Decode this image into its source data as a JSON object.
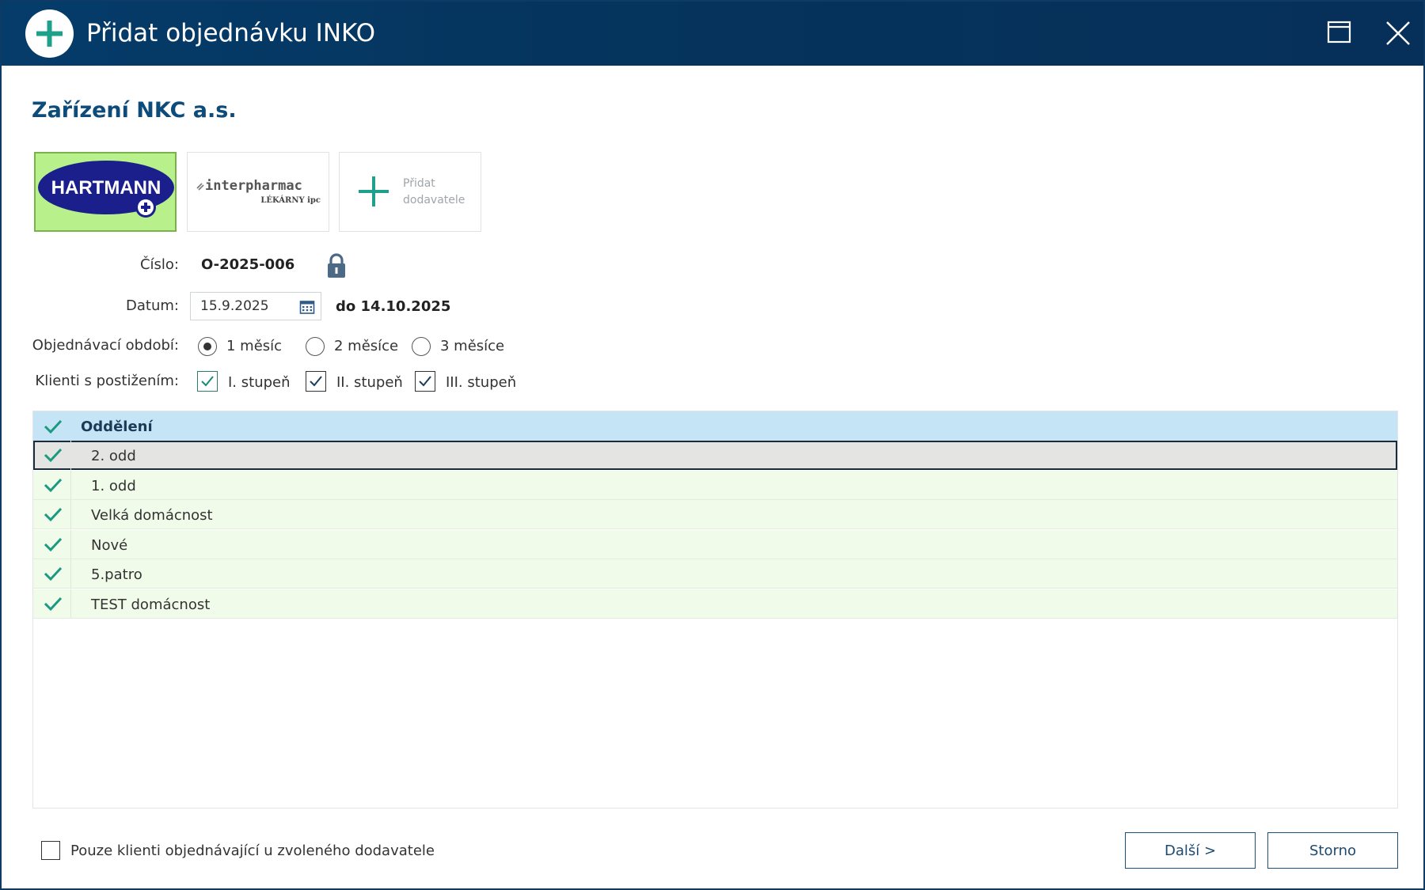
{
  "window": {
    "title": "Přidat objednávku INKO",
    "title_bar_color": "#053c6a",
    "accent_color": "#1fa08a"
  },
  "company": {
    "name": "Zařízení NKC a.s."
  },
  "suppliers": [
    {
      "name": "HARTMANN",
      "selected": true,
      "logo": "hartmann-logo",
      "highlight_color": "#b8f08b"
    },
    {
      "name": "interpharmac",
      "subtitle": "LÉKÁRNY ipc",
      "selected": false,
      "logo": "interpharmac-logo"
    },
    {
      "label": "Přidat dodavatele",
      "label_line1": "Přidat",
      "label_line2": "dodavatele",
      "icon": "plus-icon"
    }
  ],
  "form": {
    "cislo_label": "Číslo:",
    "cislo_value": "O-2025-006",
    "cislo_icon": "lock-icon",
    "datum_label": "Datum:",
    "datum_value": "15.9.2025",
    "datum_icon": "calendar-icon",
    "datum_to": "do 14.10.2025",
    "obdobi_label": "Objednávací období:",
    "obdobi_options": [
      {
        "label": "1 měsíc",
        "selected": true
      },
      {
        "label": "2 měsíce",
        "selected": false
      },
      {
        "label": "3 měsíce",
        "selected": false
      }
    ],
    "klienti_label": "Klienti s postižením:",
    "klienti_options": [
      {
        "label": "I. stupeň",
        "checked": true
      },
      {
        "label": "II. stupeň",
        "checked": true
      },
      {
        "label": "III. stupeň",
        "checked": true
      }
    ]
  },
  "table": {
    "header": "Oddělení",
    "header_bg": "#c5e4f6",
    "row_bg": "#f1fbea",
    "rows": [
      {
        "name": "2. odd",
        "checked": true,
        "selected": true
      },
      {
        "name": "1. odd",
        "checked": true,
        "selected": false
      },
      {
        "name": "Velká domácnost",
        "checked": true,
        "selected": false
      },
      {
        "name": "Nové",
        "checked": true,
        "selected": false
      },
      {
        "name": "5.patro",
        "checked": true,
        "selected": false
      },
      {
        "name": "TEST domácnost",
        "checked": true,
        "selected": false
      }
    ]
  },
  "footer": {
    "only_clients_label": "Pouze klienti objednávající u zvoleného dodavatele",
    "only_clients_checked": false,
    "next_label": "Další >",
    "cancel_label": "Storno"
  }
}
